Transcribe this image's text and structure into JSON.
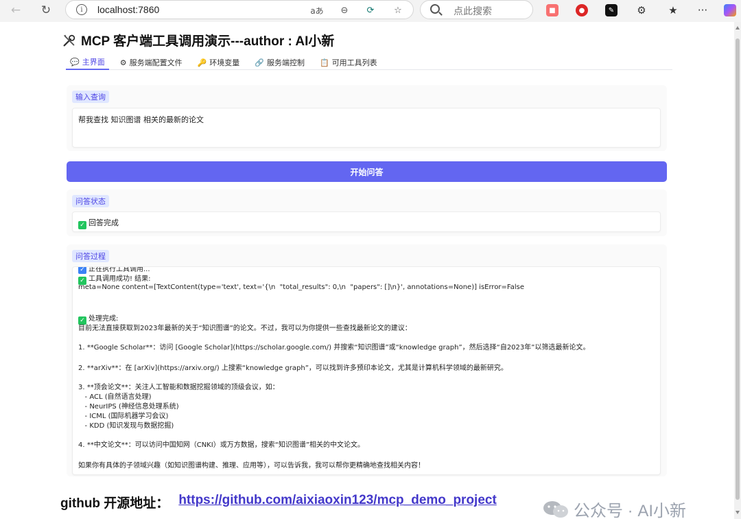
{
  "browser": {
    "url": "localhost:7860",
    "search_placeholder": "点此搜索",
    "read_aloud_glyph": "aあ",
    "menu_glyph": "···"
  },
  "app": {
    "title": "MCP 客户端工具调用演示---author : AI小新"
  },
  "tabs": [
    {
      "label": "主界面",
      "icon": "chat-icon",
      "glyph": "💬",
      "active": true
    },
    {
      "label": "服务端配置文件",
      "icon": "gear-icon",
      "glyph": "⚙",
      "active": false
    },
    {
      "label": "环境变量",
      "icon": "key-icon",
      "glyph": "🔑",
      "active": false
    },
    {
      "label": "服务端控制",
      "icon": "link-icon",
      "glyph": "🔗",
      "active": false
    },
    {
      "label": "可用工具列表",
      "icon": "list-icon",
      "glyph": "📋",
      "active": false
    }
  ],
  "query": {
    "label": "输入查询",
    "value": "帮我查找 知识图谱 相关的最新的论文"
  },
  "submit": {
    "label": "开始问答"
  },
  "status": {
    "label": "问答状态",
    "check": "✓",
    "text": "回答完成"
  },
  "process": {
    "label": "问答过程",
    "partial_top": "正在执行工具调用...",
    "tool_ok": "工具调用成功! 结果:",
    "meta_line": "meta=None content=[TextContent(type='text', text='{\\n  \"total_results\": 0,\\n  \"papers\": []\\n}', annotations=None)] isError=False",
    "done": "处理完成:",
    "lines": [
      "目前无法直接获取到2023年最新的关于“知识图谱”的论文。不过，我可以为你提供一些查找最新论文的建议：",
      "",
      "1. **Google Scholar**：访问 [Google Scholar](https://scholar.google.com/) 并搜索“知识图谱”或“knowledge graph”，然后选择“自2023年”以筛选最新论文。",
      "",
      "2. **arXiv**：在 [arXiv](https://arxiv.org/) 上搜索“knowledge graph”，可以找到许多预印本论文，尤其是计算机科学领域的最新研究。",
      "",
      "3. **顶会论文**：关注人工智能和数据挖掘领域的顶级会议，如：",
      "   - ACL (自然语言处理)",
      "   - NeurIPS (神经信息处理系统)",
      "   - ICML (国际机器学习会议)",
      "   - KDD (知识发现与数据挖掘)",
      "",
      "4. **中文论文**：可以访问中国知网（CNKI）或万方数据，搜索“知识图谱”相关的中文论文。",
      "",
      "如果你有具体的子领域兴趣（如知识图谱构建、推理、应用等），可以告诉我，我可以帮你更精确地查找相关内容！"
    ]
  },
  "footer": {
    "label": "github 开源地址：",
    "link": "https://github.com/aixiaoxin123/mcp_demo_project"
  },
  "watermark": {
    "text": "公众号 · AI小新"
  },
  "colors": {
    "accent": "#6366f1",
    "chip_bg": "#e0e7ff",
    "check_green": "#22c55e"
  }
}
